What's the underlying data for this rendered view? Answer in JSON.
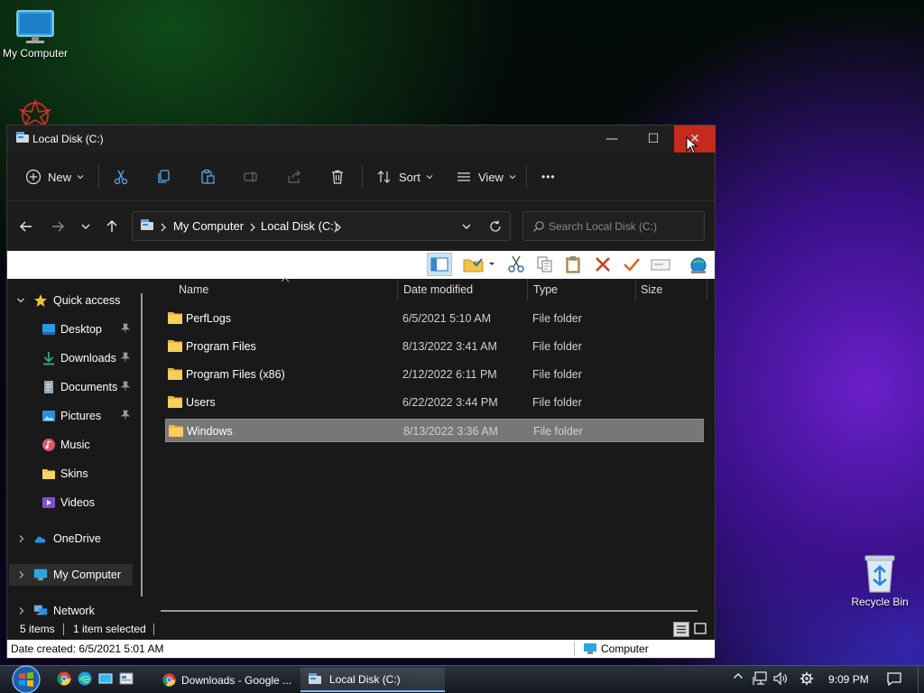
{
  "desktop": {
    "my_computer_label": "My Computer",
    "recycle_bin_label": "Recycle Bin"
  },
  "window": {
    "title": "Local Disk (C:)",
    "minimize": "—",
    "maximize": "☐",
    "close": "✕"
  },
  "command_bar": {
    "new_label": "New",
    "sort_label": "Sort",
    "view_label": "View",
    "more_label": "•••"
  },
  "address": {
    "crumbs": [
      "My Computer",
      "Local Disk (C:)"
    ],
    "search_placeholder": "Search Local Disk (C:)"
  },
  "nav_pane": {
    "quick_access": "Quick access",
    "items": [
      {
        "label": "Desktop"
      },
      {
        "label": "Downloads"
      },
      {
        "label": "Documents"
      },
      {
        "label": "Pictures"
      },
      {
        "label": "Music"
      },
      {
        "label": "Skins"
      },
      {
        "label": "Videos"
      }
    ],
    "onedrive": "OneDrive",
    "my_computer": "My Computer",
    "network": "Network"
  },
  "columns": {
    "name": "Name",
    "date_modified": "Date modified",
    "type": "Type",
    "size": "Size"
  },
  "files": [
    {
      "name": "PerfLogs",
      "date": "6/5/2021 5:10 AM",
      "type": "File folder"
    },
    {
      "name": "Program Files",
      "date": "8/13/2022 3:41 AM",
      "type": "File folder"
    },
    {
      "name": "Program Files (x86)",
      "date": "2/12/2022 6:11 PM",
      "type": "File folder"
    },
    {
      "name": "Users",
      "date": "6/22/2022 3:44 PM",
      "type": "File folder"
    },
    {
      "name": "Windows",
      "date": "8/13/2022 3:36 AM",
      "type": "File folder"
    }
  ],
  "status": {
    "items": "5 items",
    "selected": "1 item selected",
    "date_created": "Date created: 6/5/2021 5:01 AM",
    "location": "Computer"
  },
  "taskbar": {
    "tasks": [
      {
        "label": "Downloads - Google ..."
      },
      {
        "label": "Local Disk (C:)"
      }
    ],
    "clock": "9:09 PM"
  },
  "colors": {
    "close_button": "#c42b1c",
    "selected_row": "#777777",
    "folder_yellow": "#f5c542"
  }
}
